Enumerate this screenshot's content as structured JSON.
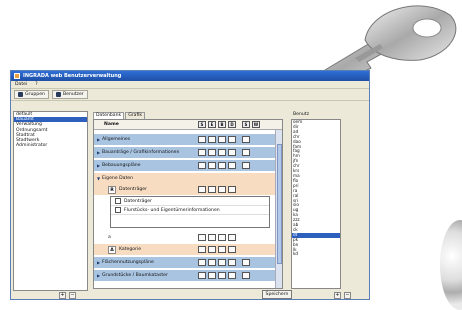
{
  "window": {
    "title": "INGRADA web Benutzerverwaltung"
  },
  "menu": [
    "Datei",
    "?"
  ],
  "toolbar": {
    "groups_label": "Gruppen",
    "users_label": "Benutzer"
  },
  "left_list": {
    "items": [
      "default",
      "Bauamt",
      "Verwaltung",
      "Ordnungsamt",
      "Stadtrat",
      "Stadtwerk",
      "Administrator"
    ],
    "selected_index": 1
  },
  "tabs": [
    "Datenbank",
    "Grafik"
  ],
  "grid": {
    "header_name": "Name",
    "header_cols": [
      "S",
      "E",
      "B",
      "D",
      "S",
      "W"
    ],
    "rows": [
      {
        "label": "Allgemeines",
        "style": "blue"
      },
      {
        "label": "Bauanträge / Grafikinformationen",
        "style": "blue"
      },
      {
        "label": "Bebauungspläne",
        "style": "blue"
      },
      {
        "label": "Eigene Daten",
        "style": "peach"
      },
      {
        "label": "Datenträger",
        "style": "peach"
      },
      {
        "label": "",
        "style": "white"
      },
      {
        "label": "Kategorie",
        "style": "peach"
      },
      {
        "label": "Flächennutzungspläne",
        "style": "blue"
      },
      {
        "label": "Grundstücke / Baumkataster",
        "style": "blue"
      }
    ],
    "icon_letters": {
      "r": "R",
      "a": "A"
    },
    "popup_items": [
      "Datenträger",
      "Flurstücks- und Eigentümerinformationen"
    ],
    "extra_row_letter": "a"
  },
  "save_label": "Speichern",
  "right_panel": {
    "label": "Benutz",
    "items": [
      "oem",
      "dir",
      "ad",
      "chr",
      "dao",
      "fam",
      "fag",
      "hrn",
      "jfn",
      "chr",
      "krs",
      "ma",
      "flo",
      "pri",
      "ra",
      "ral",
      "sri",
      "sio",
      "ug",
      "ka",
      "zzz",
      "ab",
      "ck",
      "dt",
      "pk",
      "bn",
      "lk",
      "kd"
    ],
    "selected_index": 23
  }
}
